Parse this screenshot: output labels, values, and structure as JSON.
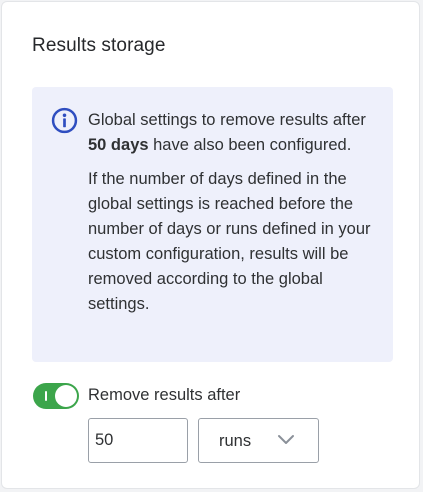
{
  "section": {
    "title": "Results storage"
  },
  "info": {
    "line1_before": "Global settings to remove results after ",
    "line1_bold": "50 days",
    "line1_after": " have also been configured.",
    "paragraph2": "If the number of days defined in the global settings is reached before the number of days or runs defined in your custom configuration, results will be removed according to the global settings.",
    "icon": "info-icon",
    "icon_color": "#2f4ec0",
    "background_color": "#eef0fb"
  },
  "removal": {
    "toggle_on": true,
    "toggle_color": "#3ca54b",
    "label": "Remove results after",
    "value": "50",
    "unit": "runs",
    "unit_icon": "chevron-down-icon"
  }
}
